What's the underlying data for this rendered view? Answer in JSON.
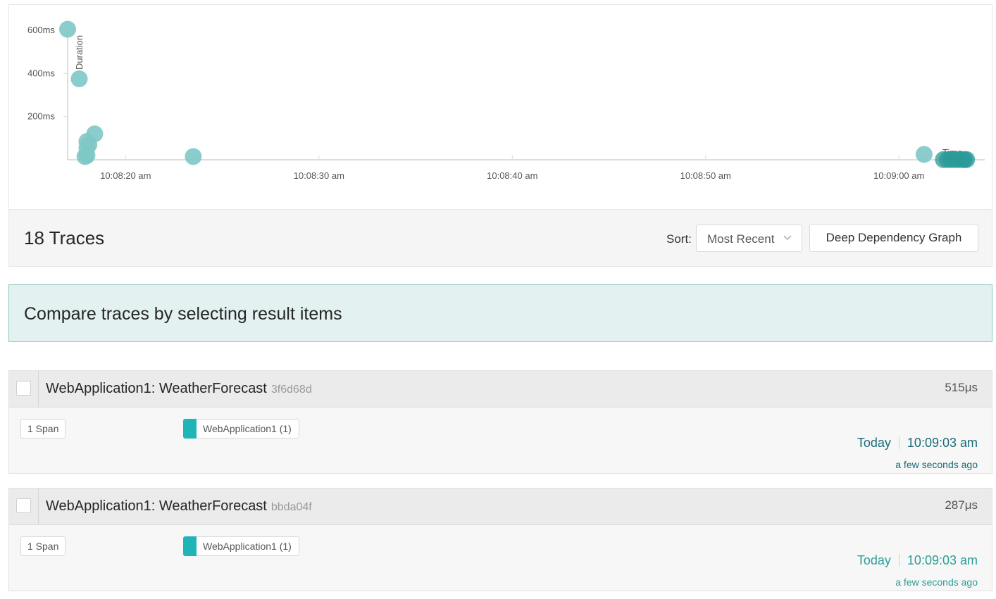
{
  "colors": {
    "point": "#7ec8c6",
    "point_dense": "#2b9a98",
    "service": "#1fb5b8",
    "accent": "#1f8a8a"
  },
  "chart_data": {
    "type": "scatter",
    "title": "",
    "xlabel": "Time",
    "ylabel": "Duration",
    "y_unit": "ms",
    "y_ticks": [
      "600ms",
      "400ms",
      "200ms"
    ],
    "y_tick_values": [
      600,
      400,
      200
    ],
    "x_ticks": [
      "10:08:20 am",
      "10:08:30 am",
      "10:08:40 am",
      "10:08:50 am",
      "10:09:00 am"
    ],
    "x_tick_seconds": [
      20,
      30,
      40,
      50,
      60
    ],
    "x_range_seconds": [
      17,
      64
    ],
    "ylim": [
      0,
      610
    ],
    "series": [
      {
        "points": [
          {
            "t": 17.0,
            "duration_ms": 605
          },
          {
            "t": 17.6,
            "duration_ms": 375
          },
          {
            "t": 18.4,
            "duration_ms": 120
          },
          {
            "t": 18.0,
            "duration_ms": 85
          },
          {
            "t": 18.1,
            "duration_ms": 70
          },
          {
            "t": 18.0,
            "duration_ms": 55
          },
          {
            "t": 18.0,
            "duration_ms": 20
          },
          {
            "t": 17.9,
            "duration_ms": 15
          },
          {
            "t": 23.5,
            "duration_ms": 15
          },
          {
            "t": 61.3,
            "duration_ms": 25
          },
          {
            "t": 62.3,
            "duration_ms": 1
          },
          {
            "t": 62.5,
            "duration_ms": 1
          },
          {
            "t": 62.7,
            "duration_ms": 1
          },
          {
            "t": 62.9,
            "duration_ms": 1
          },
          {
            "t": 63.1,
            "duration_ms": 1
          },
          {
            "t": 63.3,
            "duration_ms": 1
          },
          {
            "t": 63.4,
            "duration_ms": 1
          },
          {
            "t": 63.5,
            "duration_ms": 1
          }
        ]
      }
    ]
  },
  "results": {
    "count_label": "18 Traces",
    "sort_label": "Sort:",
    "sort_value": "Most Recent",
    "ddg_label": "Deep Dependency Graph"
  },
  "compare_banner": "Compare traces by selecting result items",
  "traces": [
    {
      "name": "WebApplication1: WeatherForecast",
      "id": "3f6d68d",
      "duration": "515μs",
      "spans": "1 Span",
      "service": "WebApplication1 (1)",
      "date": "Today",
      "time": "10:09:03 am",
      "relative": "a few seconds ago"
    },
    {
      "name": "WebApplication1: WeatherForecast",
      "id": "bbda04f",
      "duration": "287μs",
      "spans": "1 Span",
      "service": "WebApplication1 (1)",
      "date": "Today",
      "time": "10:09:03 am",
      "relative": "a few seconds ago"
    }
  ]
}
